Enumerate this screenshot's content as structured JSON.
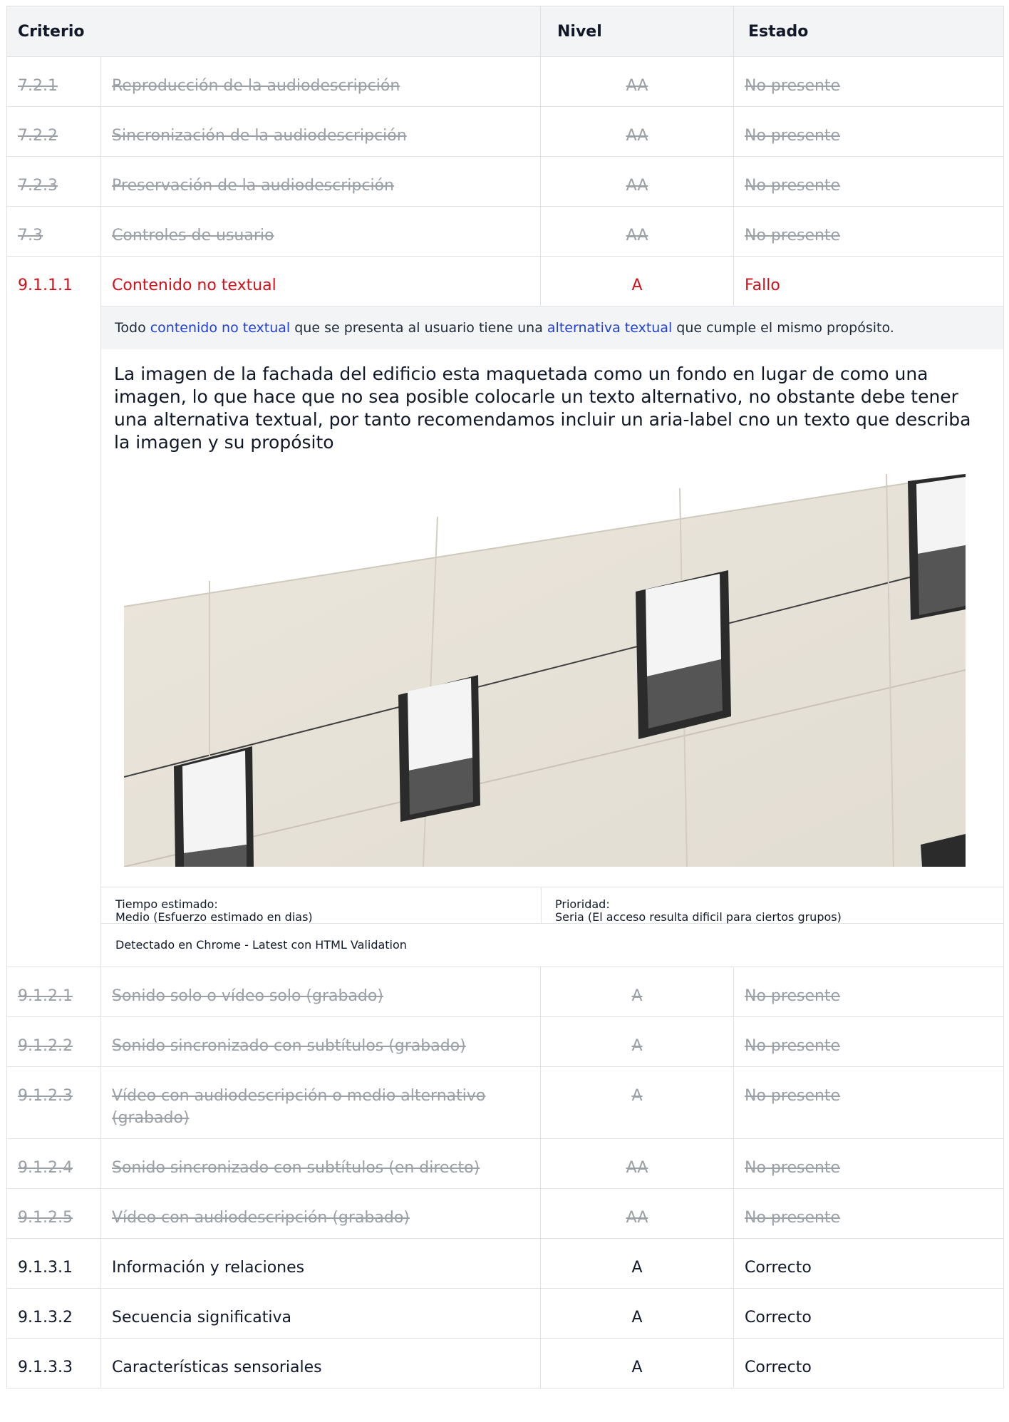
{
  "header": {
    "criterio": "Criterio",
    "nivel": "Nivel",
    "estado": "Estado"
  },
  "rows_top": [
    {
      "id": "7.2.1",
      "title": "Reproducción de la audiodescripción",
      "level": "AA",
      "status": "No presente"
    },
    {
      "id": "7.2.2",
      "title": "Sincronización de la audiodescripción",
      "level": "AA",
      "status": "No presente"
    },
    {
      "id": "7.2.3",
      "title": "Preservación de la audiodescripción",
      "level": "AA",
      "status": "No presente"
    },
    {
      "id": "7.3",
      "title": "Controles de usuario",
      "level": "AA",
      "status": "No presente"
    }
  ],
  "fail_row": {
    "id": "9.1.1.1",
    "title": "Contenido no textual",
    "level": "A",
    "status": "Fallo"
  },
  "detail": {
    "desc_pre": "Todo ",
    "desc_link1": "contenido no textual",
    "desc_mid": " que se presenta al usuario tiene una ",
    "desc_link2": "alternativa textual",
    "desc_post": " que cumple el mismo propósito.",
    "body": "La imagen de la fachada del edificio esta maquetada como un fondo en lugar de como una imagen, lo que hace que no sea posible colocarle un texto alternativo, no obstante debe tener una alternativa textual, por tanto recomendamos incluir un aria-label cno un texto que describa la imagen y su propósito",
    "time_label": "Tiempo estimado:",
    "time_value": "Medio (Esfuerzo estimado en dias)",
    "priority_label": "Prioridad:",
    "priority_value": "Seria (El acceso resulta dificil para ciertos grupos)",
    "detected": "Detectado en Chrome - Latest con HTML Validation"
  },
  "rows_np": [
    {
      "id": "9.1.2.1",
      "title": "Sonido solo o vídeo solo (grabado)",
      "level": "A",
      "status": "No presente"
    },
    {
      "id": "9.1.2.2",
      "title": "Sonido sincronizado con subtítulos (grabado)",
      "level": "A",
      "status": "No presente"
    },
    {
      "id": "9.1.2.3",
      "title_line1": "Vídeo con audiodescripción o medio alternativo",
      "title_line2": "(grabado)",
      "level": "A",
      "status": "No presente"
    },
    {
      "id": "9.1.2.4",
      "title": "Sonido sincronizado con subtítulos (en directo)",
      "level": "AA",
      "status": "No presente"
    },
    {
      "id": "9.1.2.5",
      "title": "Vídeo con audiodescripción (grabado)",
      "level": "AA",
      "status": "No presente"
    }
  ],
  "rows_ok": [
    {
      "id": "9.1.3.1",
      "title": "Información y relaciones",
      "level": "A",
      "status": "Correcto"
    },
    {
      "id": "9.1.3.2",
      "title": "Secuencia significativa",
      "level": "A",
      "status": "Correcto"
    },
    {
      "id": "9.1.3.3",
      "title": "Características sensoriales",
      "level": "A",
      "status": "Correcto"
    }
  ]
}
